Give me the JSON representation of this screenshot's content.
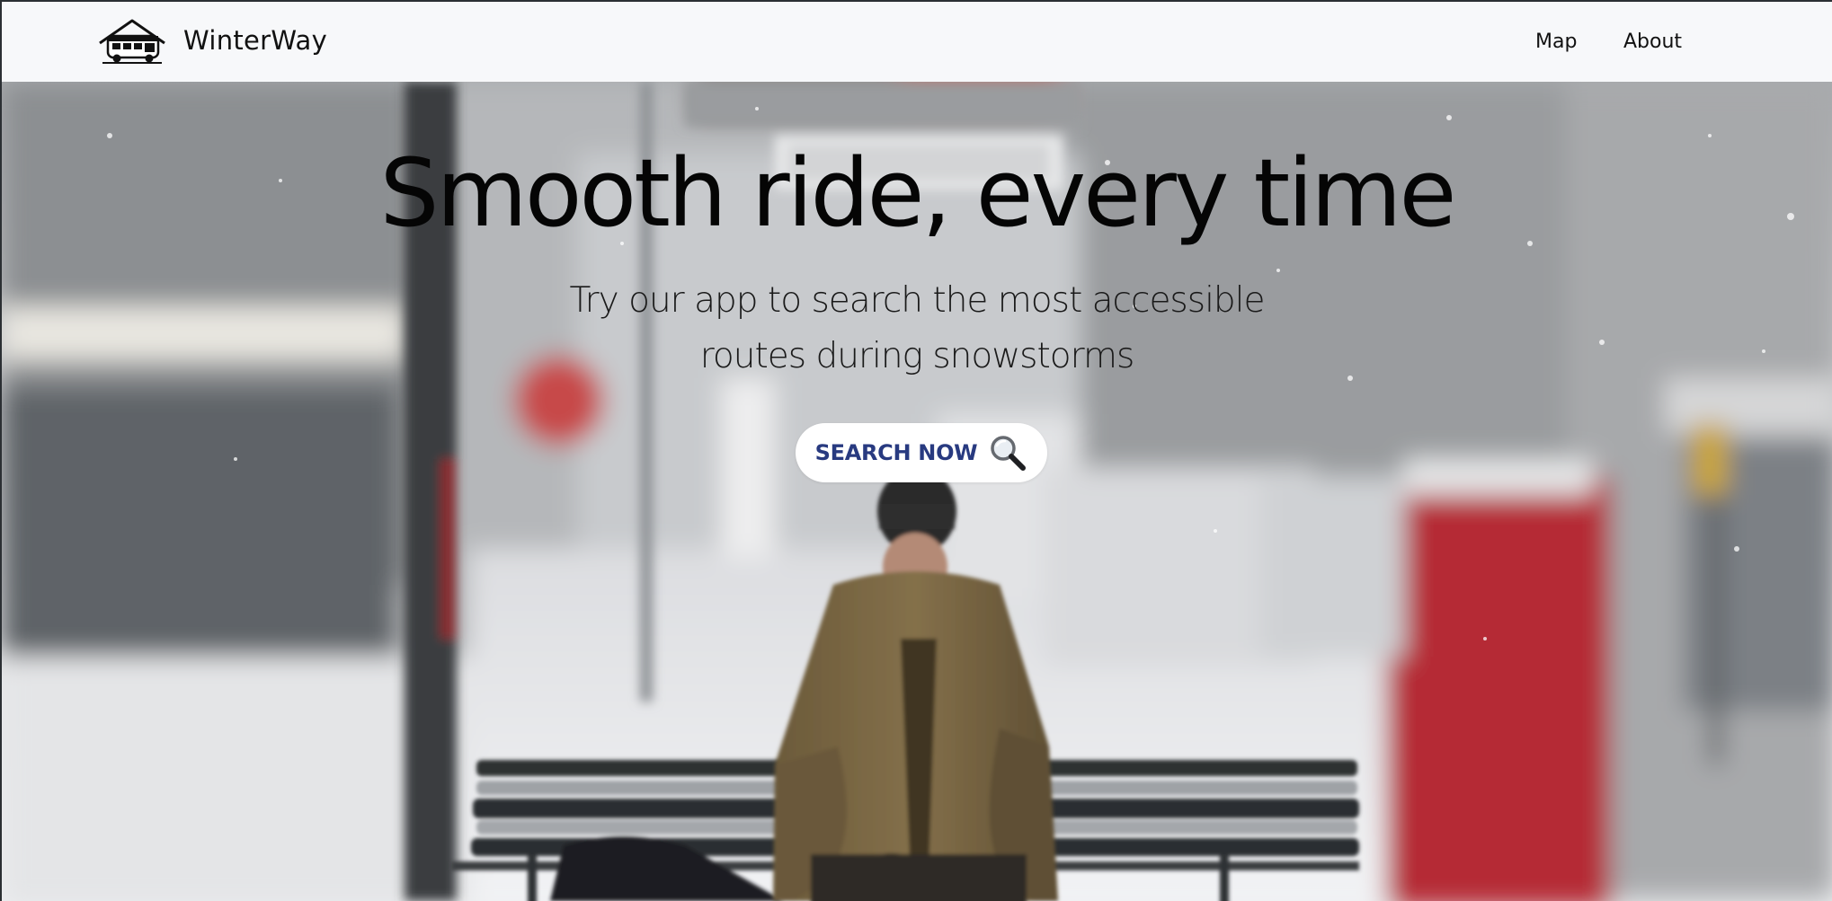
{
  "brand": {
    "name": "WinterWay",
    "logo_icon": "bus-house-logo-icon"
  },
  "nav": {
    "items": [
      {
        "label": "Map"
      },
      {
        "label": "About"
      }
    ]
  },
  "hero": {
    "title": "Smooth ride, every time",
    "subtitle_line1": "Try our app to search the most accessible",
    "subtitle_line2": "routes during snowstorms",
    "cta_label": "SEARCH NOW",
    "cta_icon": "magnifying-glass-icon",
    "background_photo": "person in brown coat sitting on a snowy bus stop bench"
  },
  "colors": {
    "navbar_bg": "#f7f8fa",
    "cta_text": "#283a80",
    "title_text": "#050505"
  }
}
